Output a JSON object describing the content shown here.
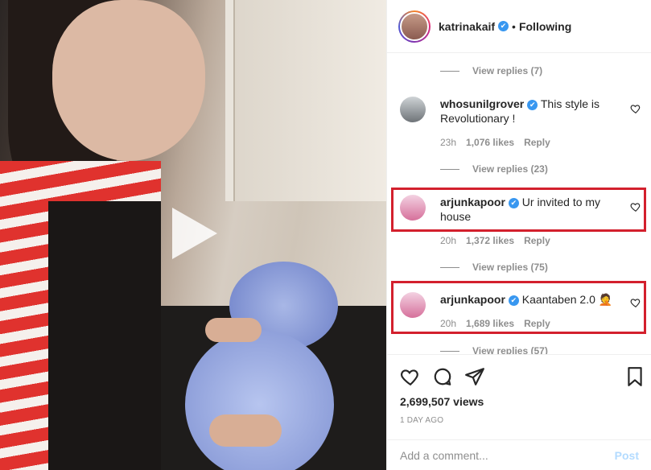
{
  "post": {
    "author": "katrinakaif",
    "follow_status": "Following",
    "separator": "•",
    "verified_mark": "✔"
  },
  "comments_section": {
    "replies": [
      {
        "label": "View replies (7)"
      },
      {
        "label": "View replies (23)"
      },
      {
        "label": "View replies (75)"
      },
      {
        "label": "View replies (57)"
      }
    ],
    "items": [
      {
        "user": "whosunilgrover",
        "text": "This style is Revolutionary !",
        "age": "23h",
        "likes": "1,076 likes",
        "reply": "Reply",
        "verified": true
      },
      {
        "user": "arjunkapoor",
        "text": "Ur invited to my house",
        "age": "20h",
        "likes": "1,372 likes",
        "reply": "Reply",
        "verified": true
      },
      {
        "user": "arjunkapoor",
        "text": "Kaantaben 2.0 🤦",
        "age": "20h",
        "likes": "1,689 likes",
        "reply": "Reply",
        "verified": true
      }
    ]
  },
  "stats": {
    "views": "2,699,507 views",
    "date": "1 DAY AGO"
  },
  "composer": {
    "placeholder": "Add a comment...",
    "post_label": "Post"
  },
  "colors": {
    "highlight": "#d3202d",
    "verified": "#3897f0",
    "muted": "#8e8e8e"
  }
}
